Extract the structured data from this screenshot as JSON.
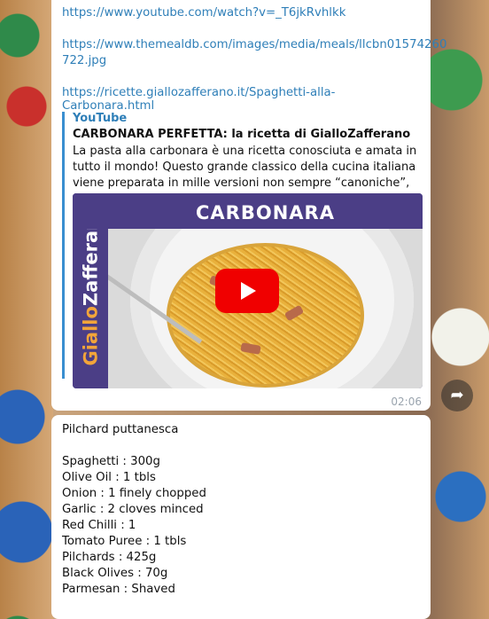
{
  "message1": {
    "links": [
      "https://www.youtube.com/watch?v=_T6jkRvhlkk",
      "https://www.themealdb.com/images/media/meals/llcbn01574260",
      "722.jpg",
      "https://ricette.giallozafferano.it/Spaghetti-alla-Carbonara.html"
    ],
    "preview": {
      "site": "YouTube",
      "title": "CARBONARA PERFETTA: la ricetta di GialloZafferano",
      "description": "La pasta alla carbonara è una ricetta conosciuta e amata in tutto il mondo! Questo grande classico della cucina italiana viene preparata in mille versioni non sempre “canoniche”, ma la ricett…",
      "thumbnail_heading": "CARBONARA",
      "logo_main": "Giallo",
      "logo_accent": "Zafferano"
    },
    "time": "02:06",
    "share_icon": "share-arrow-icon"
  },
  "message2": {
    "title": "Pilchard puttanesca",
    "ingredients": [
      "Spaghetti : 300g",
      "Olive Oil : 1 tbls",
      "Onion : 1 finely chopped",
      "Garlic : 2 cloves minced",
      "Red Chilli : 1",
      "Tomato Puree : 1 tbls",
      "Pilchards : 425g",
      "Black Olives : 70g",
      "Parmesan : Shaved"
    ]
  },
  "colors": {
    "link": "#2f7fb8",
    "accent_bar": "#3a8fd0",
    "youtube_red": "#f00000",
    "thumbnail_purple": "#4b3e86"
  }
}
